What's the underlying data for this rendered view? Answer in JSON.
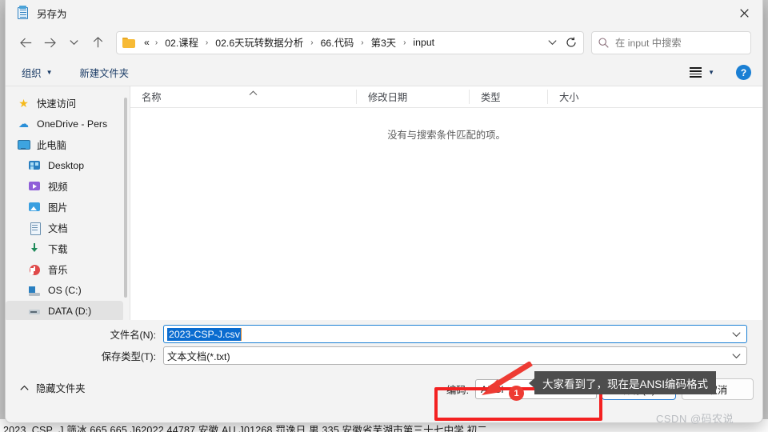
{
  "window": {
    "title": "另存为",
    "icon": "notepad-icon",
    "close_label": "✕"
  },
  "nav": {
    "back_icon": "arrow-left-icon",
    "forward_icon": "arrow-right-icon",
    "recent_icon": "chevron-down-icon",
    "up_icon": "arrow-up-icon",
    "refresh_icon": "refresh-icon",
    "breadcrumb_lead": "«",
    "breadcrumbs": [
      "02.课程",
      "02.6天玩转数据分析",
      "66.代码",
      "第3天",
      "input"
    ],
    "separator": "›",
    "dropdown_icon": "chevron-down-icon"
  },
  "search": {
    "placeholder": "在 input 中搜索",
    "icon": "search-icon"
  },
  "commandbar": {
    "organize_label": "组织",
    "new_folder_label": "新建文件夹",
    "view_icon": "list-view-icon",
    "help_label": "?"
  },
  "sidebar": {
    "items": [
      {
        "label": "快速访问",
        "icon": "star-icon",
        "indent": false,
        "selected": false
      },
      {
        "label": "OneDrive - Pers",
        "icon": "cloud-icon",
        "indent": false,
        "selected": false
      },
      {
        "label": "此电脑",
        "icon": "computer-icon",
        "indent": false,
        "selected": false
      },
      {
        "label": "Desktop",
        "icon": "desktop-icon",
        "indent": true,
        "selected": false
      },
      {
        "label": "视频",
        "icon": "video-icon",
        "indent": true,
        "selected": false
      },
      {
        "label": "图片",
        "icon": "picture-icon",
        "indent": true,
        "selected": false
      },
      {
        "label": "文档",
        "icon": "document-icon",
        "indent": true,
        "selected": false
      },
      {
        "label": "下载",
        "icon": "download-icon",
        "indent": true,
        "selected": false
      },
      {
        "label": "音乐",
        "icon": "music-icon",
        "indent": true,
        "selected": false
      },
      {
        "label": "OS (C:)",
        "icon": "drive-icon",
        "indent": true,
        "selected": false
      },
      {
        "label": "DATA (D:)",
        "icon": "drive-icon",
        "indent": true,
        "selected": true
      }
    ]
  },
  "filelist": {
    "columns": [
      "名称",
      "修改日期",
      "类型",
      "大小"
    ],
    "empty_message": "没有与搜索条件匹配的项。",
    "sort_icon": "sort-ascending-icon"
  },
  "form": {
    "filename_label": "文件名(N):",
    "filename_value": "2023-CSP-J.csv",
    "filetype_label": "保存类型(T):",
    "filetype_value": "文本文档(*.txt)",
    "chevron_icon": "chevron-down-icon"
  },
  "bottom": {
    "hide_folders_label": "隐藏文件夹",
    "hide_folders_icon": "chevron-up-icon",
    "encoding_label": "编码:",
    "encoding_value": "ANSI",
    "save_label": "保存(S)",
    "cancel_label": "取消"
  },
  "annotations": {
    "badge_number": "1",
    "tooltip_text": "大家看到了，现在是ANSI编码格式",
    "highlight_color": "#f32121",
    "accent_color": "#2a7fd4",
    "watermark": "CSDN @码农说"
  },
  "background": {
    "text": "2023_CSP_J    筛冰  665  665  J62022 44787 安徽 AU J01268 罚逸日 男  335  安徽省芜湖市第三十七中学 初二"
  }
}
